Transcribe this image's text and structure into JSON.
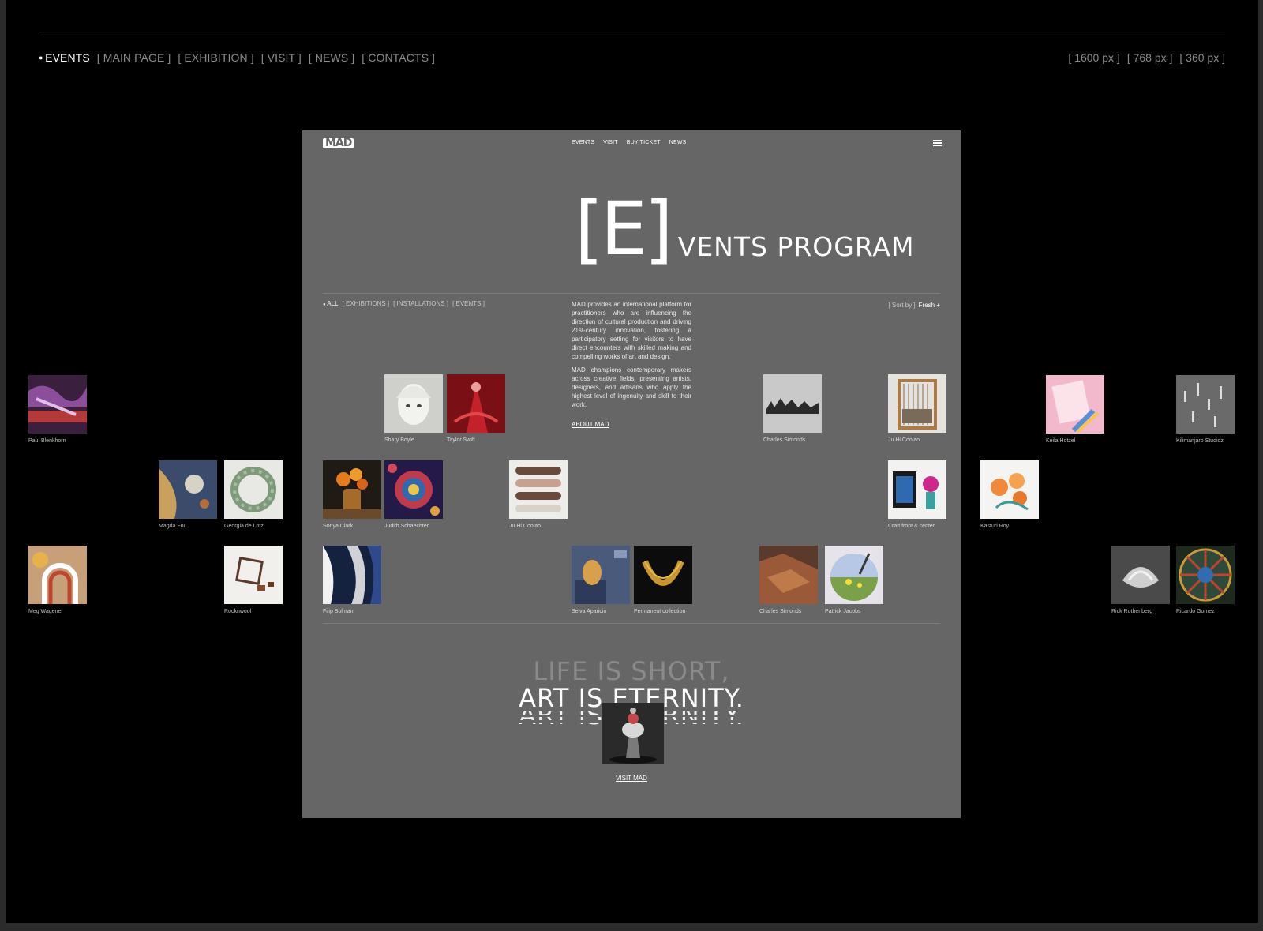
{
  "top_nav": {
    "active": "EVENTS",
    "items": [
      "[ MAIN PAGE ]",
      "[ EXHIBITION ]",
      "[ VISIT ]",
      "[ NEWS ]",
      "[ CONTACTS ]"
    ]
  },
  "sizes": [
    "[ 1600 px ]",
    "[ 768 px ]",
    "[ 360 px ]"
  ],
  "preview": {
    "logo": "MAD",
    "nav": [
      "EVENTS",
      "VISIT",
      "BUY TICKET",
      "NEWS"
    ],
    "hero": {
      "bracket": "[E]",
      "rest": "VENTS PROGRAM"
    },
    "filters": {
      "active": "ALL",
      "items": [
        "[ EXHIBITIONS ]",
        "[ INSTALLATIONS ]",
        "[ EVENTS ]"
      ]
    },
    "about_p1": "MAD provides an international platform for practitioners who are influencing the direction of cultural production and driving 21st-century innovation, fostering a participatory setting for visitors to have direct encounters with skilled making and compelling works of art and design.",
    "about_p2": "MAD champions contemporary makers across creative fields, presenting artists, designers, and artisans who apply the highest level of ingenuity and skill to their work.",
    "about_link": "ABOUT MAD",
    "sort": {
      "label": "[ Sort by ]",
      "value": "Fresh +"
    },
    "slogan_1": "LIFE IS SHORT,",
    "slogan_2": "ART IS ETERNITY.",
    "visit_link": "VISIT MAD"
  },
  "tiles": [
    "Shary Boyle",
    "Taylor Swift",
    "Charles Simonds",
    "Ju Hi Coolao",
    "Sonya Clark",
    "Judith Schaechter",
    "Ju Hi Coolao",
    "Craft front & center",
    "Filip Bolman",
    "Selva Aparicio",
    "Permanent collection",
    "Charles Simonds",
    "Patrick Jacobs"
  ],
  "outside_tiles": [
    "Paul Blenkhorn",
    "Magda Fou",
    "Georgia de Lotz",
    "Meg Wagener",
    "Rocknwool",
    "Keila Hotzel",
    "Kilimanjaro Studioz",
    "Kasturi Roy",
    "Rick Rothenberg",
    "Ricardo Gomez"
  ]
}
